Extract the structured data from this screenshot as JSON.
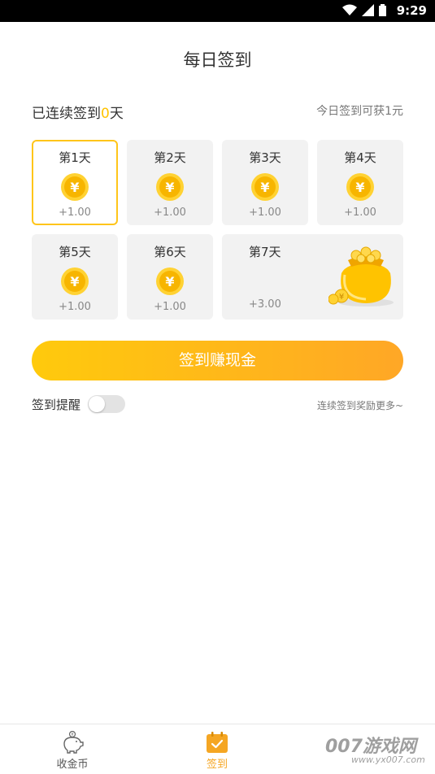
{
  "status_bar": {
    "time": "9:29"
  },
  "page": {
    "title": "每日签到"
  },
  "streak": {
    "prefix": "已连续签到",
    "count": "0",
    "suffix": "天"
  },
  "reward_note": "今日签到可获1元",
  "days": [
    {
      "label": "第1天",
      "amount": "+1.00"
    },
    {
      "label": "第2天",
      "amount": "+1.00"
    },
    {
      "label": "第3天",
      "amount": "+1.00"
    },
    {
      "label": "第4天",
      "amount": "+1.00"
    },
    {
      "label": "第5天",
      "amount": "+1.00"
    },
    {
      "label": "第6天",
      "amount": "+1.00"
    },
    {
      "label": "第7天",
      "amount": "+3.00"
    }
  ],
  "coin_symbol": "¥",
  "cta_label": "签到赚现金",
  "reminder": {
    "label": "签到提醒",
    "enabled": false
  },
  "more_note": "连续签到奖励更多~",
  "tabs": [
    {
      "label": "收金币",
      "icon": "piggy-bank-icon"
    },
    {
      "label": "签到",
      "icon": "calendar-check-icon",
      "active": true
    }
  ],
  "watermark": {
    "text": "007游戏网",
    "url": "www.yx007.com"
  },
  "colors": {
    "accent": "#ffc300",
    "cta_start": "#ffca0c",
    "cta_end": "#ffa726",
    "active_tab": "#f5a623"
  }
}
